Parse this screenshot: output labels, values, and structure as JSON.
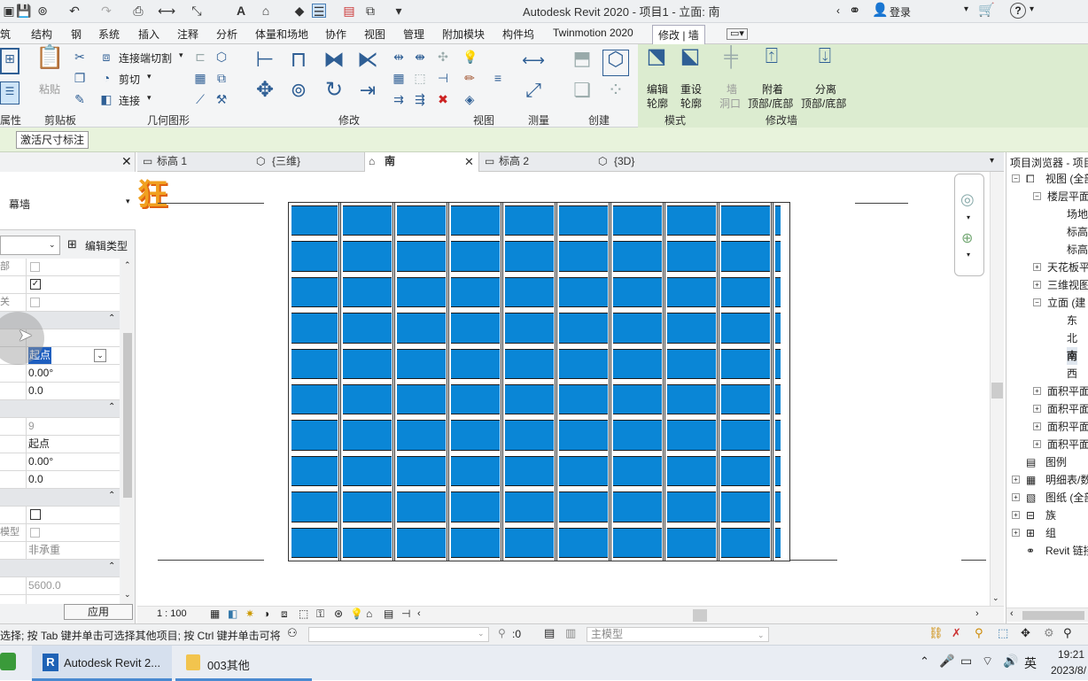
{
  "window": {
    "title": "Autodesk Revit 2020 - 项目1 - 立面: 南",
    "login": "登录"
  },
  "menu": [
    "筑",
    "结构",
    "钢",
    "系统",
    "插入",
    "注释",
    "分析",
    "体量和场地",
    "协作",
    "视图",
    "管理",
    "附加模块",
    "构件坞",
    "Twinmotion 2020",
    "修改 | 墙"
  ],
  "ribbon": {
    "tools": {
      "cut_join": "连接端切割",
      "cut": "剪切",
      "join": "连接",
      "paste": "粘贴",
      "edit_profile": [
        "编辑",
        "轮廓"
      ],
      "reset_profile": [
        "重设",
        "轮廓"
      ],
      "wall_opening": [
        "墙",
        "洞口"
      ],
      "attach": [
        "附着",
        "顶部/底部"
      ],
      "detach": [
        "分离",
        "顶部/底部"
      ]
    },
    "panels": [
      "属性",
      "剪贴板",
      "几何图形",
      "修改",
      "视图",
      "测量",
      "创建",
      "模式",
      "修改墙"
    ]
  },
  "options_bar": {
    "button": "激活尺寸标注"
  },
  "properties": {
    "type_name": "幕墙",
    "edit_type": "编辑类型",
    "apply": "应用",
    "rows": [
      {
        "label": "部",
        "value": ""
      },
      {
        "label": "",
        "value": ""
      },
      {
        "label": "关",
        "value": ""
      },
      {
        "label": "",
        "value": ""
      },
      {
        "label": "",
        "value": "起点"
      },
      {
        "label": "",
        "value": "0.00°"
      },
      {
        "label": "",
        "value": "0.0"
      },
      {
        "label": "",
        "value": ""
      },
      {
        "label": "",
        "value": "9"
      },
      {
        "label": "",
        "value": "起点"
      },
      {
        "label": "",
        "value": "0.00°"
      },
      {
        "label": "",
        "value": "0.0"
      },
      {
        "label": "",
        "value": ""
      },
      {
        "label": "",
        "value": ""
      },
      {
        "label": "模型",
        "value": ""
      },
      {
        "label": "",
        "value": "非承重"
      },
      {
        "label": "",
        "value": ""
      },
      {
        "label": "",
        "value": "5600.0"
      }
    ]
  },
  "tabs": [
    {
      "label": "标高 1"
    },
    {
      "label": "{三维}"
    },
    {
      "label": "南"
    },
    {
      "label": "标高 2"
    },
    {
      "label": "{3D}"
    }
  ],
  "view": {
    "scale": "1 : 100",
    "watermark": "狂",
    "grid_columns": 9,
    "grid_rows": 10
  },
  "browser": {
    "title": "项目浏览器 - 项目",
    "items": [
      {
        "label": "视图 (全部",
        "indent": 1
      },
      {
        "label": "楼层平面",
        "indent": 2
      },
      {
        "label": "场地",
        "indent": 3
      },
      {
        "label": "标高",
        "indent": 3
      },
      {
        "label": "标高",
        "indent": 3
      },
      {
        "label": "天花板平",
        "indent": 2
      },
      {
        "label": "三维视图",
        "indent": 2
      },
      {
        "label": "立面 (建",
        "indent": 2
      },
      {
        "label": "东",
        "indent": 3
      },
      {
        "label": "北",
        "indent": 3
      },
      {
        "label": "南",
        "indent": 3
      },
      {
        "label": "西",
        "indent": 3
      },
      {
        "label": "面积平面",
        "indent": 2
      },
      {
        "label": "面积平面",
        "indent": 2
      },
      {
        "label": "面积平面",
        "indent": 2
      },
      {
        "label": "面积平面",
        "indent": 2
      },
      {
        "label": "图例",
        "indent": 1
      },
      {
        "label": "明细表/数",
        "indent": 1
      },
      {
        "label": "图纸 (全部",
        "indent": 1
      },
      {
        "label": "族",
        "indent": 1
      },
      {
        "label": "组",
        "indent": 1
      },
      {
        "label": "Revit 链接",
        "indent": 1
      }
    ]
  },
  "status": {
    "hint": "选择; 按 Tab 键并单击可选择其他项目; 按 Ctrl 键并单击可将",
    "count": ":0",
    "model": "主模型"
  },
  "taskbar": {
    "apps": [
      "Autodesk Revit 2...",
      "003其他"
    ],
    "ime": "英",
    "time": "19:21",
    "date": "2023/8/"
  },
  "colors": {
    "panel": "#0a86d6",
    "mullion": "#ffffff",
    "context_tab": "#dcecd0"
  }
}
